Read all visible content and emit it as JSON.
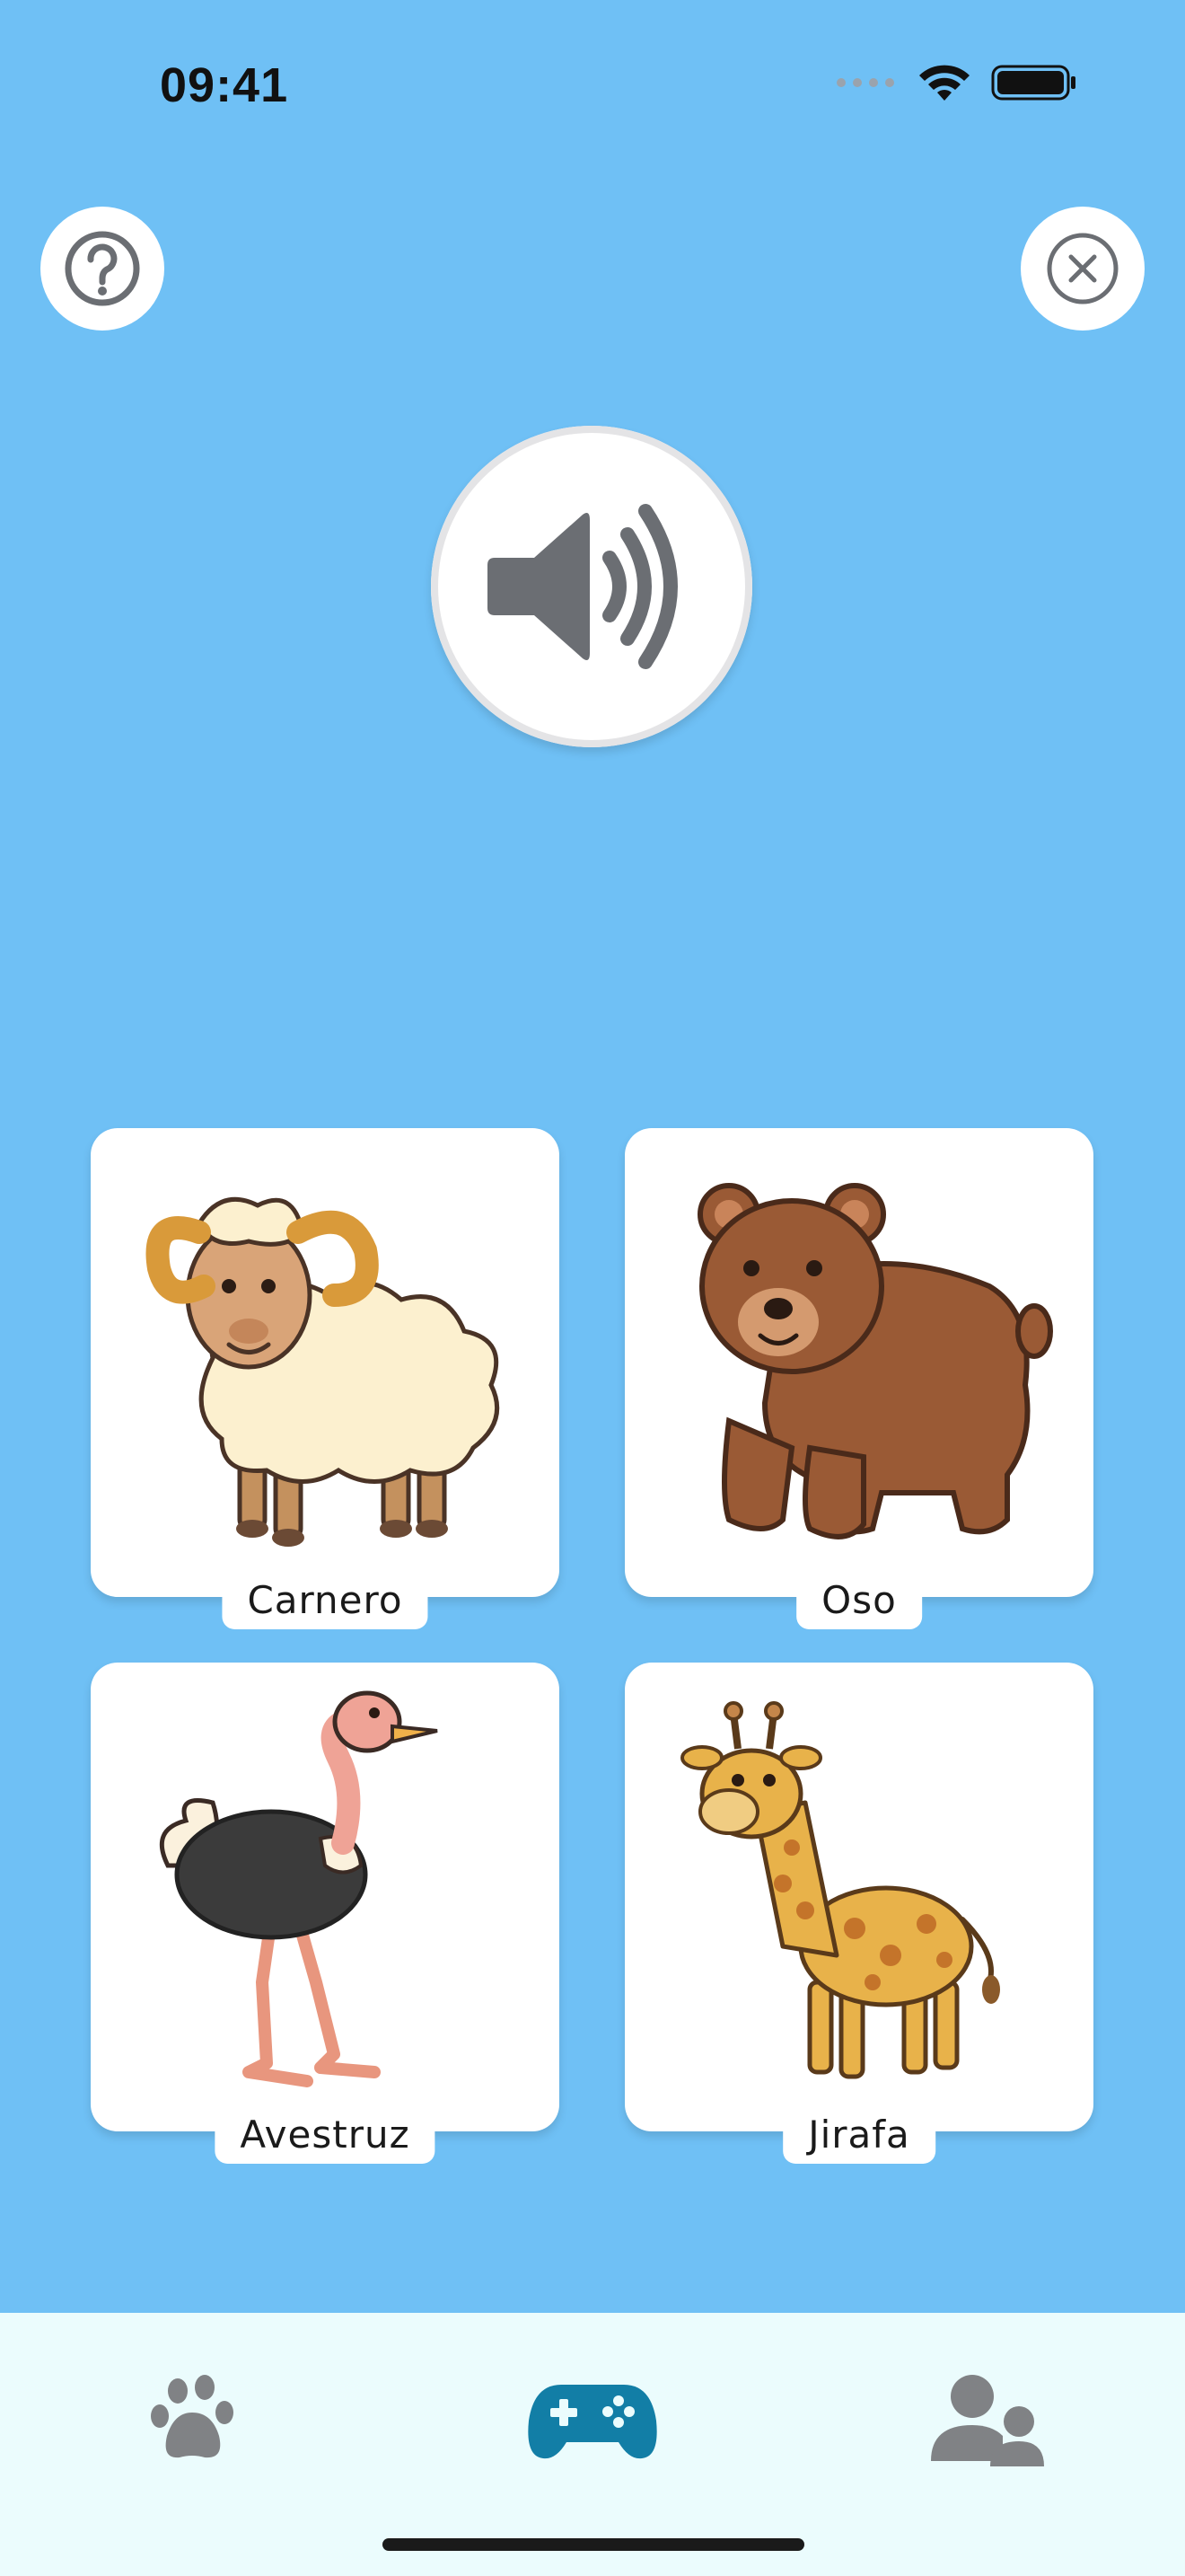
{
  "status_bar": {
    "time": "09:41"
  },
  "header": {
    "help_icon": "question-circle-icon",
    "close_icon": "close-circle-icon"
  },
  "prompt": {
    "speaker_icon": "speaker-volume-icon"
  },
  "choices": [
    {
      "label": "Carnero",
      "image": "ram"
    },
    {
      "label": "Oso",
      "image": "bear"
    },
    {
      "label": "Avestruz",
      "image": "ostrich"
    },
    {
      "label": "Jirafa",
      "image": "giraffe"
    }
  ],
  "tab_bar": {
    "items": [
      {
        "icon": "paw-icon",
        "active": false
      },
      {
        "icon": "gamepad-icon",
        "active": true
      },
      {
        "icon": "users-icon",
        "active": false
      }
    ],
    "active_color": "#127ea6",
    "inactive_color": "#808285"
  },
  "colors": {
    "background": "#6fc0f5",
    "card": "#ffffff",
    "tab_bar": "#ebfcfd"
  }
}
